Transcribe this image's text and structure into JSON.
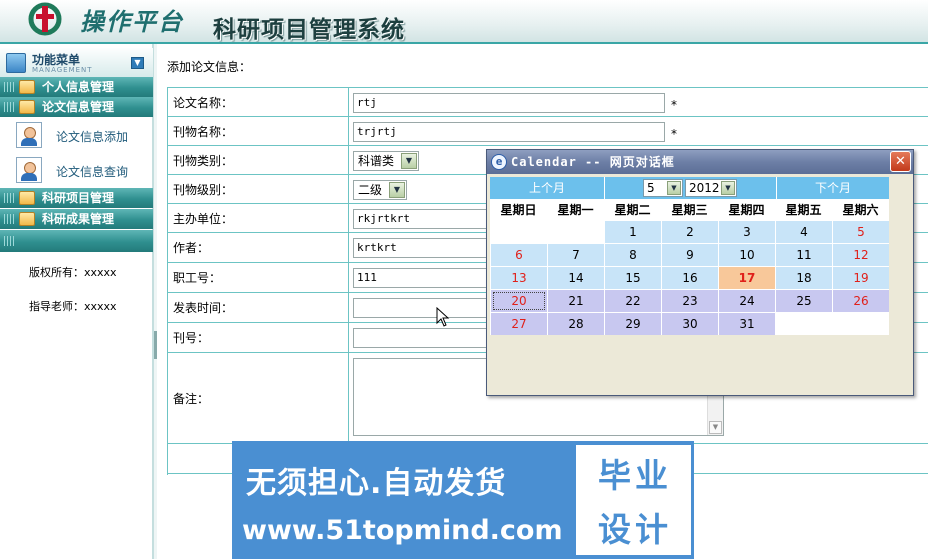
{
  "header": {
    "brand": "操作平台",
    "system_title": "科研项目管理系统"
  },
  "sidebar": {
    "menu_title": "功能菜单",
    "menu_subtitle": "MANAGEMENT",
    "items": [
      {
        "label": "个人信息管理"
      },
      {
        "label": "论文信息管理"
      },
      {
        "label": "论文信息添加"
      },
      {
        "label": "论文信息查询"
      },
      {
        "label": "科研项目管理"
      },
      {
        "label": "科研成果管理"
      }
    ],
    "copyright": "版权所有：xxxxx",
    "advisor": "指导老师：xxxxx"
  },
  "form": {
    "heading": "添加论文信息：",
    "paper_name_label": "论文名称：",
    "paper_name_value": "rtj",
    "journal_name_label": "刊物名称：",
    "journal_name_value": "trjrtj",
    "journal_type_label": "刊物类别：",
    "journal_type_value": "科谱类",
    "journal_level_label": "刊物级别：",
    "journal_level_value": "二级",
    "host_unit_label": "主办单位：",
    "host_unit_value": "rkjrtkrt",
    "author_label": "作者：",
    "author_value": "krtkrt",
    "staff_id_label": "职工号：",
    "staff_id_value": "111",
    "publish_time_label": "发表时间：",
    "issue_no_label": "刊号：",
    "remark_label": "备注：",
    "required_mark": "*"
  },
  "calendar": {
    "title": "Calendar -- 网页对话框",
    "prev_label": "上个月",
    "next_label": "下个月",
    "month": "5",
    "year": "2012",
    "weekdays": [
      "星期日",
      "星期一",
      "星期二",
      "星期三",
      "星期四",
      "星期五",
      "星期六"
    ],
    "today": "17",
    "selected": "20",
    "weeks": [
      [
        "",
        "",
        "1",
        "2",
        "3",
        "4",
        "5"
      ],
      [
        "6",
        "7",
        "8",
        "9",
        "10",
        "11",
        "12"
      ],
      [
        "13",
        "14",
        "15",
        "16",
        "17",
        "18",
        "19"
      ],
      [
        "20",
        "21",
        "22",
        "23",
        "24",
        "25",
        "26"
      ],
      [
        "27",
        "28",
        "29",
        "30",
        "31",
        "",
        ""
      ]
    ]
  },
  "watermark": {
    "line1": "无须担心.自动发货",
    "line2": "www.51topmind.com",
    "stamp_line1": "毕业",
    "stamp_line2": "设计"
  },
  "icons": {
    "close": "close-icon",
    "dropdown": "chevron-down-icon",
    "ie": "ie-page-icon"
  },
  "colors": {
    "accent_teal": "#2f8f8f",
    "table_border": "#6cc4c4",
    "calendar_nav": "#6cc0ec",
    "today_bg": "#f8c89a",
    "weekend_text": "#e0201a"
  }
}
